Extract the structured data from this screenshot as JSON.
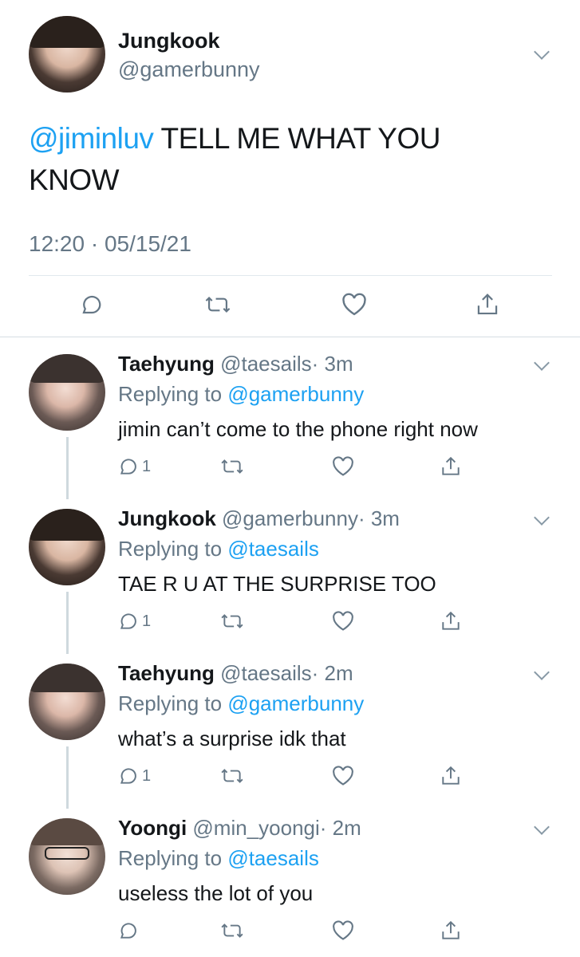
{
  "main_tweet": {
    "name": "Jungkook",
    "handle": "@gamerbunny",
    "mention": "@jiminluv",
    "text": "TELL ME WHAT YOU KNOW",
    "timestamp": "12:20 · 05/15/21"
  },
  "replies": [
    {
      "name": "Taehyung",
      "handle": "@taesails",
      "time": "· 3m",
      "replying_prefix": "Replying to",
      "replying_to": "@gamerbunny",
      "text": "jimin can’t come to the phone right now",
      "reply_count": "1"
    },
    {
      "name": "Jungkook",
      "handle": "@gamerbunny",
      "time": "· 3m",
      "replying_prefix": "Replying to",
      "replying_to": "@taesails",
      "text": "TAE R U AT THE SURPRISE TOO",
      "reply_count": "1"
    },
    {
      "name": "Taehyung",
      "handle": "@taesails",
      "time": "· 2m",
      "replying_prefix": "Replying to",
      "replying_to": "@gamerbunny",
      "text": "what’s a surprise idk that",
      "reply_count": "1"
    },
    {
      "name": "Yoongi",
      "handle": "@min_yoongi",
      "time": "· 2m",
      "replying_prefix": "Replying to",
      "replying_to": "@taesails",
      "text": "useless the lot of you",
      "reply_count": ""
    }
  ],
  "icons": [
    "reply-icon",
    "retweet-icon",
    "like-icon",
    "share-icon",
    "chevron-down-icon"
  ],
  "colors": {
    "accent": "#1da1f2",
    "muted": "#657786",
    "text": "#14171a",
    "thread_line": "#cfd9de"
  }
}
